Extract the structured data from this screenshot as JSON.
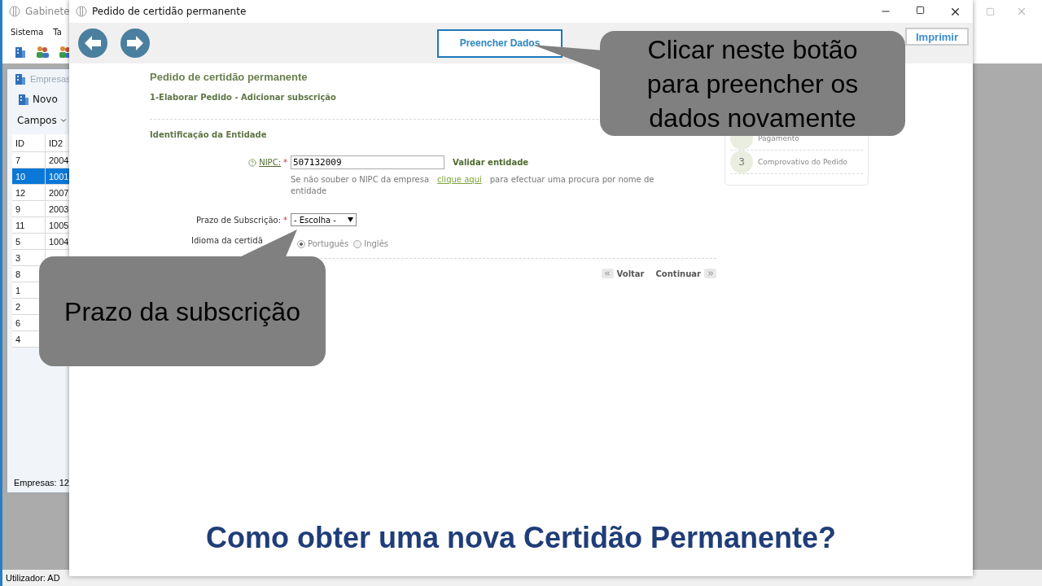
{
  "app_window": {
    "title": "Gabinete",
    "menu": [
      "Sistema",
      "Ta"
    ],
    "status_bar": "Utilizador: AD",
    "list_window": {
      "title": "Empresas",
      "new_button": "Novo",
      "fields_button": "Campos",
      "columns": [
        "ID",
        "ID2"
      ],
      "rows": [
        {
          "cells": [
            "7",
            "2004"
          ],
          "selected": false
        },
        {
          "cells": [
            "10",
            "1001"
          ],
          "selected": true
        },
        {
          "cells": [
            "12",
            "2007"
          ],
          "selected": false
        },
        {
          "cells": [
            "9",
            "2003"
          ],
          "selected": false
        },
        {
          "cells": [
            "11",
            "1005"
          ],
          "selected": false
        },
        {
          "cells": [
            "5",
            "1004"
          ],
          "selected": false
        },
        {
          "cells": [
            "3"
          ],
          "selected": false
        },
        {
          "cells": [
            "8"
          ],
          "selected": false
        },
        {
          "cells": [
            "1"
          ],
          "selected": false
        },
        {
          "cells": [
            "2"
          ],
          "selected": false
        },
        {
          "cells": [
            "6"
          ],
          "selected": false
        },
        {
          "cells": [
            "4"
          ],
          "selected": false
        }
      ],
      "footer": "Empresas: 12"
    }
  },
  "dialog": {
    "title": "Pedido de certidão permanente",
    "fill_button": "Preencher Dados",
    "print_button": "Imprimir",
    "heading": "Pedido de certidão permanente",
    "subheading": "1-Elaborar Pedido - Adicionar subscrição",
    "section": "Identificação da Entidade",
    "nipc": {
      "label": "NIPC:",
      "required_mark": "*",
      "value": "507132009",
      "validate_link": "Validar entidade"
    },
    "help": {
      "before": "Se não souber o NIPC da empresa",
      "link": "clique aqui",
      "after": "para efectuar uma procura por nome de entidade"
    },
    "term": {
      "label": "Prazo de Subscrição:",
      "required_mark": "*",
      "value": "- Escolha -"
    },
    "language": {
      "label": "Idioma da certidã",
      "options": [
        {
          "label": "Português",
          "selected": true
        },
        {
          "label": "Inglês",
          "selected": false
        }
      ]
    },
    "back_button": "Voltar",
    "continue_button": "Continuar",
    "steps": [
      {
        "label": "Pagamento"
      },
      {
        "number": "3",
        "label": "Comprovativo do Pedido"
      }
    ]
  },
  "callouts": [
    {
      "text": "Clicar neste botão para preencher os dados novamente"
    },
    {
      "text": "Prazo da subscrição"
    }
  ],
  "caption": "Como obter uma nova Certidão Permanente?"
}
